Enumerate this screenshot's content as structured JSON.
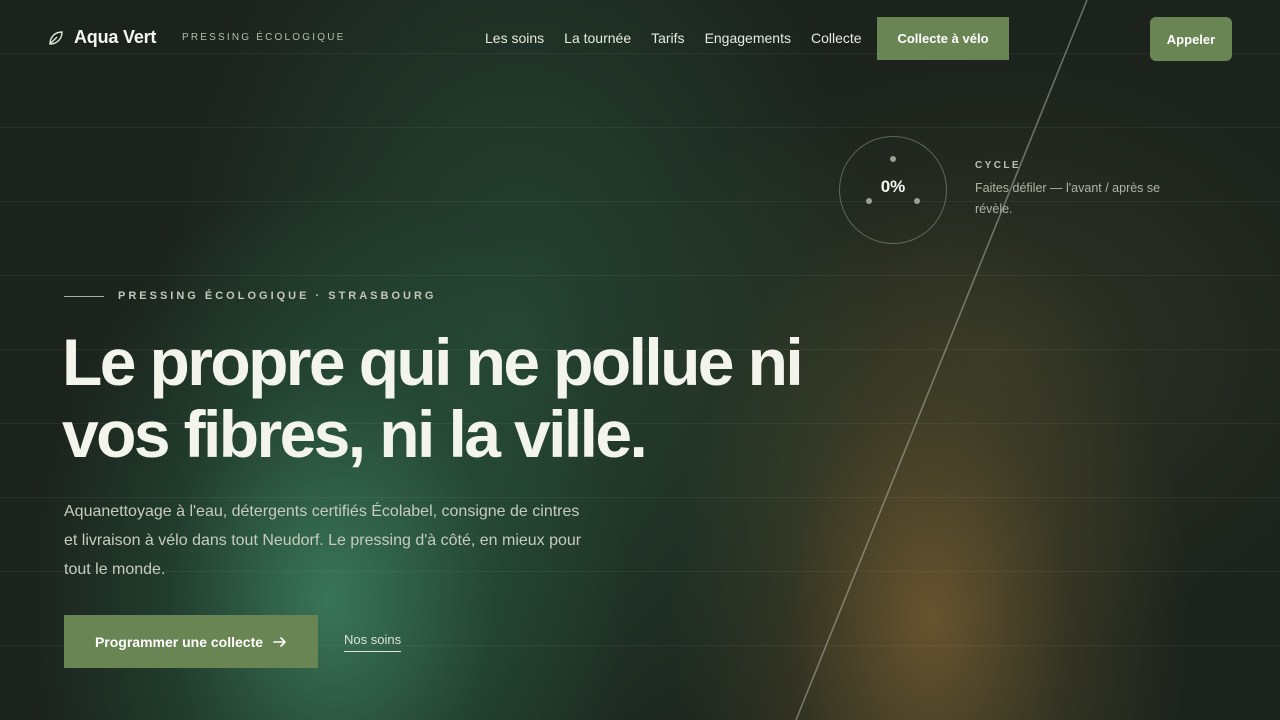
{
  "brand": {
    "name": "Aqua Vert",
    "tagline": "PRESSING ÉCOLOGIQUE"
  },
  "nav": {
    "items": [
      {
        "label": "Les soins"
      },
      {
        "label": "La tournée"
      },
      {
        "label": "Tarifs"
      },
      {
        "label": "Engagements"
      },
      {
        "label": "Collecte"
      }
    ],
    "cta_label": "Collecte à vélo",
    "call_label": "Appeler"
  },
  "cycle": {
    "percent": "0%",
    "label": "CYCLE",
    "description": "Faites défiler — l'avant / après se révèle."
  },
  "hero": {
    "eyebrow": "PRESSING ÉCOLOGIQUE · STRASBOURG",
    "headline": "Le propre qui ne pollue ni vos fibres, ni la ville.",
    "lead": "Aquanettoyage à l'eau, détergents certifiés Écolabel, consigne de cintres et livraison à vélo dans tout Neudorf. Le pressing d'à côté, en mieux pour tout le monde.",
    "primary_label": "Programmer une collecte",
    "secondary_label": "Nos soins"
  },
  "colors": {
    "accent": "#6a8554",
    "background": "#1c231d",
    "text": "#f3f5ed"
  },
  "icons": {
    "brand": "leaf-icon",
    "primary_button": "arrow-right-icon"
  }
}
